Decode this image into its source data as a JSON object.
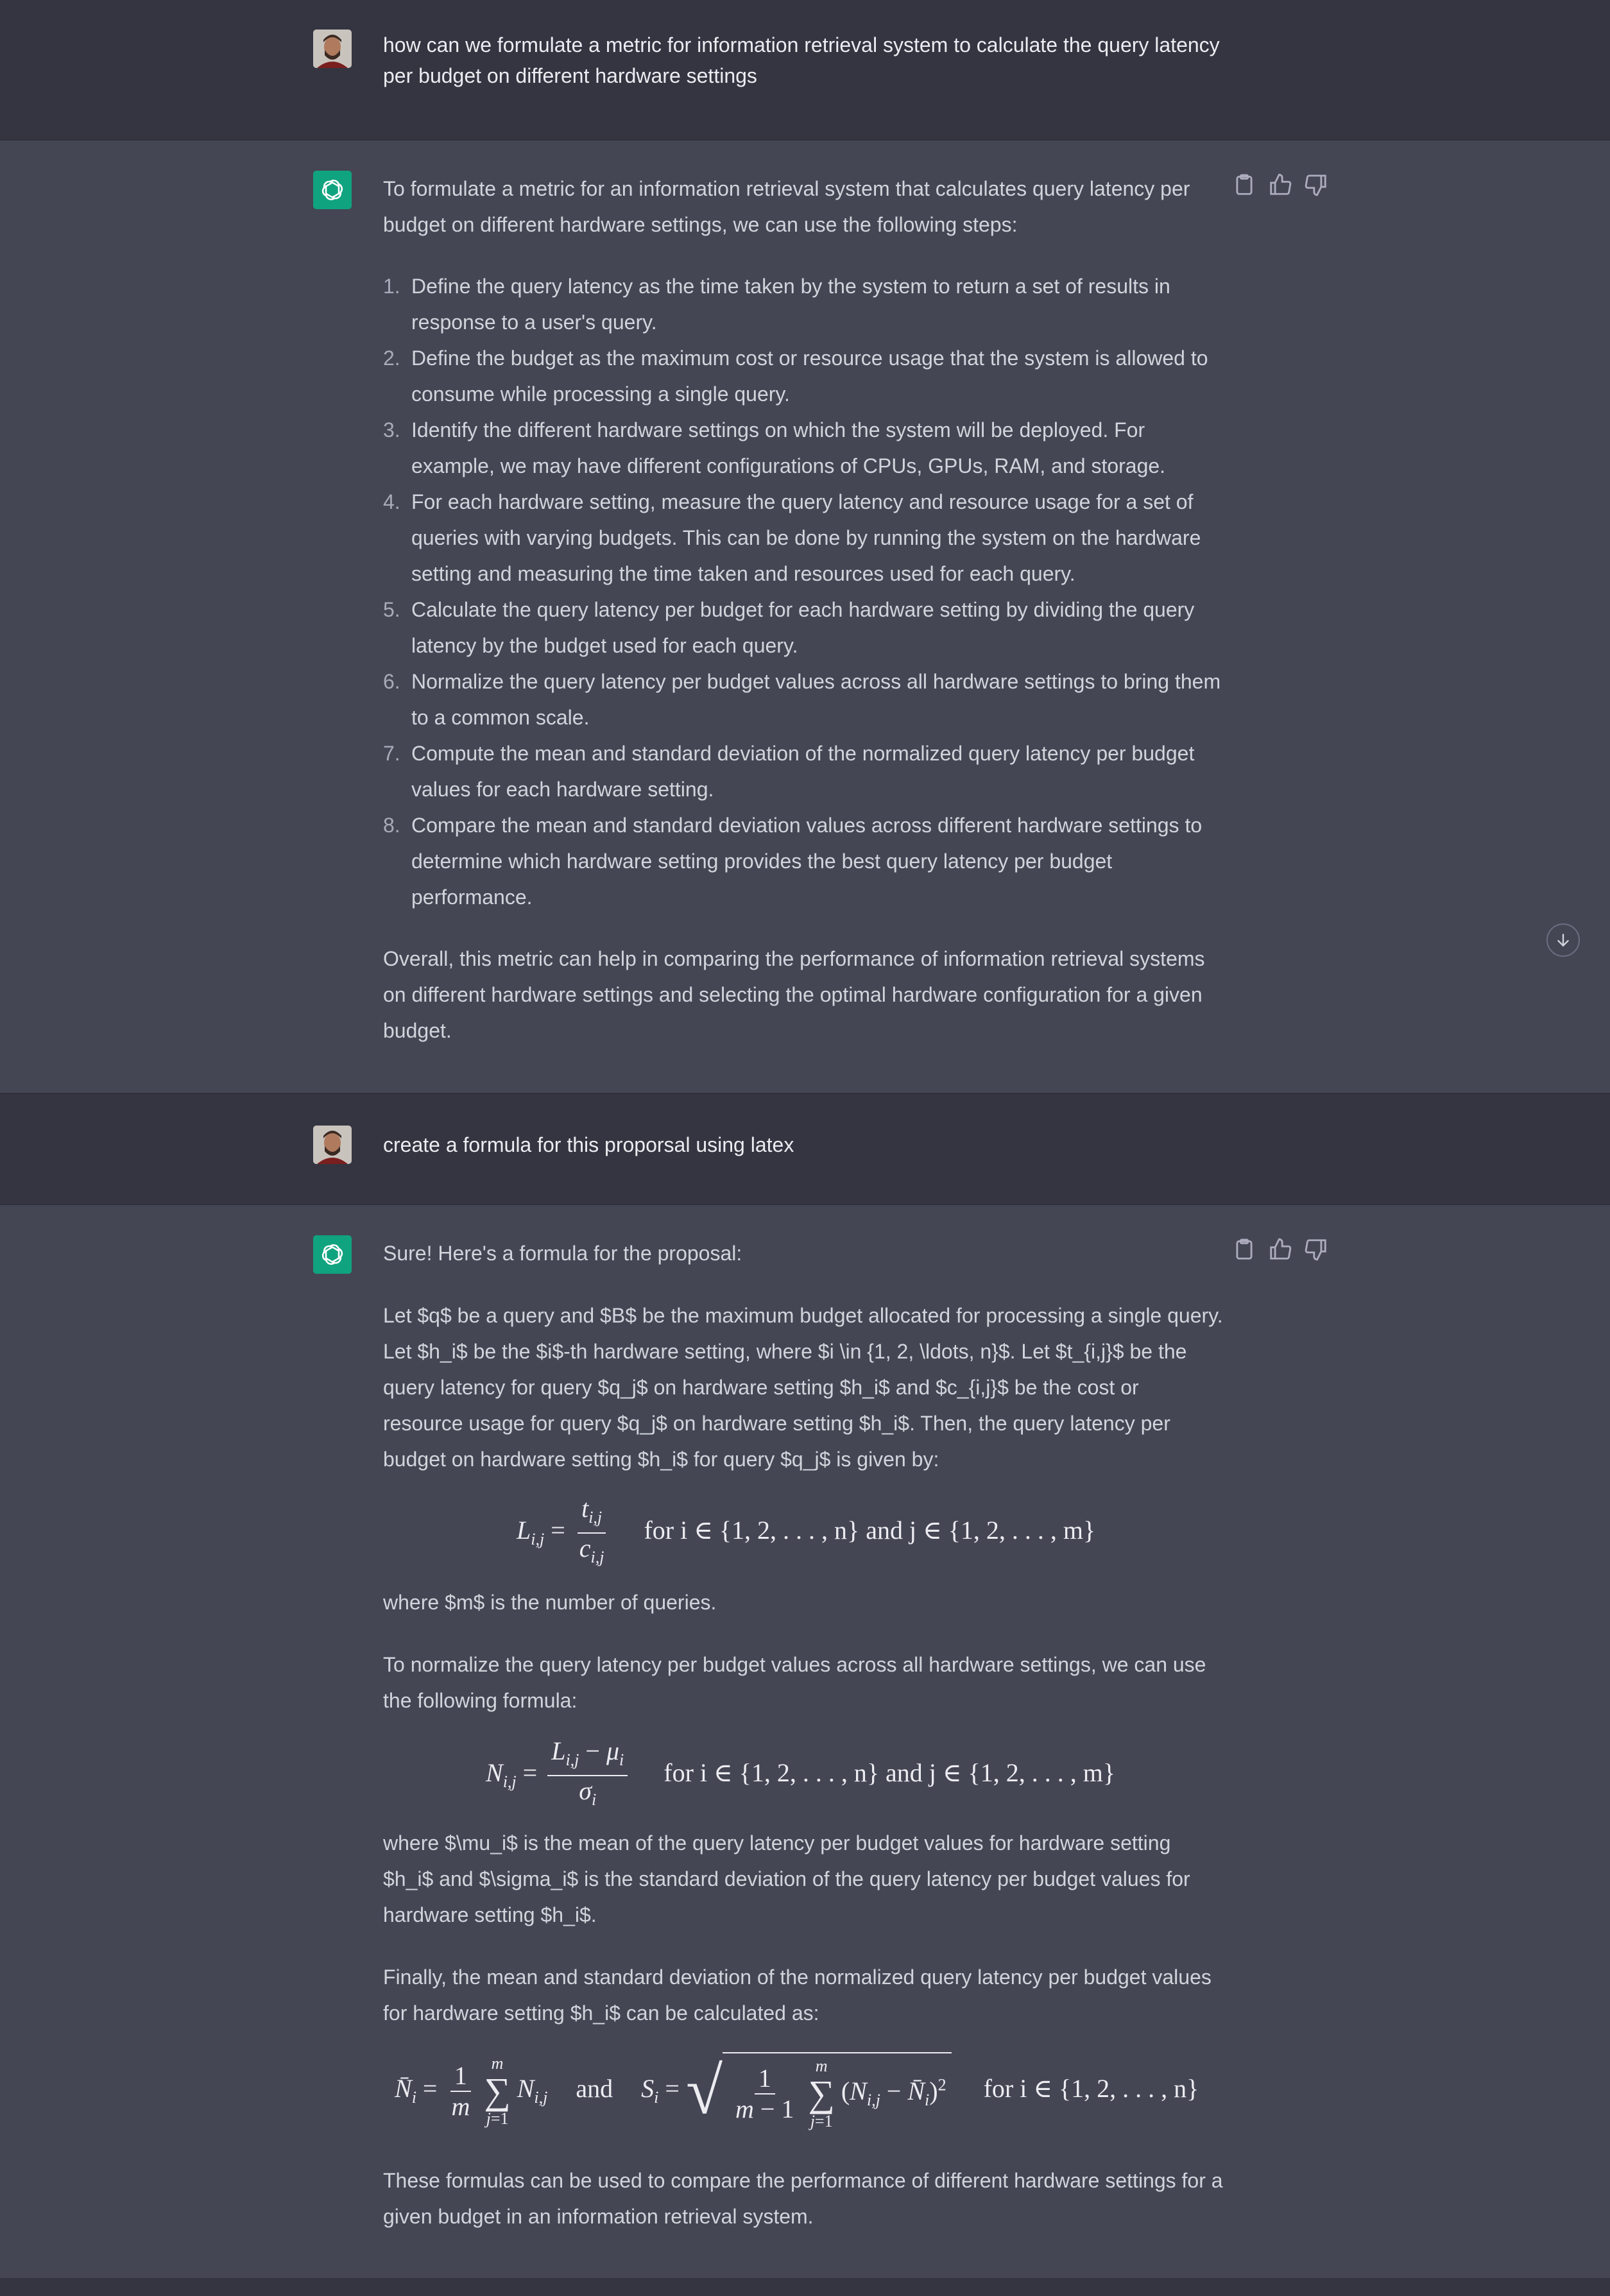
{
  "messages": {
    "q1": "how can we formulate a metric for information retrieval system to calculate the query latency per budget on different hardware settings",
    "a1": {
      "intro": "To formulate a metric for an information retrieval system that calculates query latency per budget on different hardware settings, we can use the following steps:",
      "steps": [
        {
          "num": "1.",
          "text": "Define the query latency as the time taken by the system to return a set of results in response to a user's query."
        },
        {
          "num": "2.",
          "text": "Define the budget as the maximum cost or resource usage that the system is allowed to consume while processing a single query."
        },
        {
          "num": "3.",
          "text": "Identify the different hardware settings on which the system will be deployed. For example, we may have different configurations of CPUs, GPUs, RAM, and storage."
        },
        {
          "num": "4.",
          "text": "For each hardware setting, measure the query latency and resource usage for a set of queries with varying budgets. This can be done by running the system on the hardware setting and measuring the time taken and resources used for each query."
        },
        {
          "num": "5.",
          "text": "Calculate the query latency per budget for each hardware setting by dividing the query latency by the budget used for each query."
        },
        {
          "num": "6.",
          "text": "Normalize the query latency per budget values across all hardware settings to bring them to a common scale."
        },
        {
          "num": "7.",
          "text": "Compute the mean and standard deviation of the normalized query latency per budget values for each hardware setting."
        },
        {
          "num": "8.",
          "text": "Compare the mean and standard deviation values across different hardware settings to determine which hardware setting provides the best query latency per budget performance."
        }
      ],
      "outro": "Overall, this metric can help in comparing the performance of information retrieval systems on different hardware settings and selecting the optimal hardware configuration for a given budget."
    },
    "q2": "create a formula for this proporsal using latex",
    "a2": {
      "intro": "Sure! Here's a formula for the proposal:",
      "p1": "Let $q$ be a query and $B$ be the maximum budget allocated for processing a single query. Let $h_i$ be the $i$-th hardware setting, where $i \\in {1, 2, \\ldots, n}$. Let $t_{i,j}$ be the query latency for query $q_j$ on hardware setting $h_i$ and $c_{i,j}$ be the cost or resource usage for query $q_j$ on hardware setting $h_i$. Then, the query latency per budget on hardware setting $h_i$ for query $q_j$ is given by:",
      "p2": "where $m$ is the number of queries.",
      "p3": "To normalize the query latency per budget values across all hardware settings, we can use the following formula:",
      "p4": "where $\\mu_i$ is the mean of the query latency per budget values for hardware setting $h_i$ and $\\sigma_i$ is the standard deviation of the query latency per budget values for hardware setting $h_i$.",
      "p5": "Finally, the mean and standard deviation of the normalized query latency per budget values for hardware setting $h_i$ can be calculated as:",
      "p6": "These formulas can be used to compare the performance of different hardware settings for a given budget in an information retrieval system."
    }
  },
  "math": {
    "range_text": "for i ∈ {1, 2, . . . , n} and j ∈ {1, 2, . . . , m}",
    "and_text": "and",
    "for_n_text": "for i ∈ {1, 2, . . . , n}"
  },
  "colors": {
    "user_bg": "#343541",
    "bot_bg": "#444654",
    "gpt_green": "#10a37f",
    "text": "#d1d5db"
  },
  "icons": [
    "user-avatar",
    "chatgpt-logo-icon",
    "copy-icon",
    "thumbs-up-icon",
    "thumbs-down-icon",
    "arrow-down-icon"
  ]
}
